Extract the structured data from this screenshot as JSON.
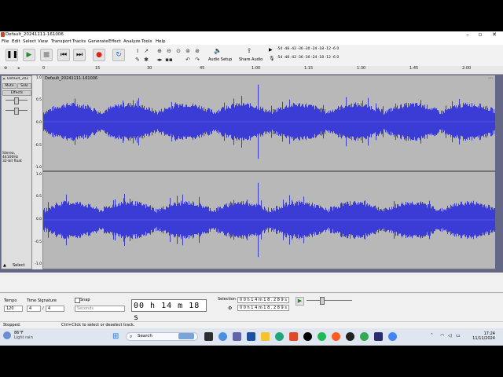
{
  "window": {
    "title": "Default_20241111-161006"
  },
  "menu": [
    "File",
    "Edit",
    "Select",
    "View",
    "Transport",
    "Tracks",
    "Generate",
    "Effect",
    "Analyze",
    "Tools",
    "Help"
  ],
  "toolbar": {
    "audio_setup": "Audio Setup",
    "share_audio": "Share Audio",
    "meter_labels": [
      "-54",
      "-48",
      "-42",
      "-36",
      "-30",
      "-24",
      "-18",
      "-12",
      "-6",
      "0"
    ]
  },
  "ruler": {
    "ticks": [
      "0",
      "15",
      "30",
      "45",
      "1:00",
      "1:15",
      "1:30",
      "1:45",
      "2:00"
    ]
  },
  "track": {
    "name": "Default_202",
    "clip_name": "Default_20241111-161006",
    "mute": "Mute",
    "solo": "Solo",
    "effects": "Effects",
    "info_line1": "Stereo, 44100Hz",
    "info_line2": "32-bit float",
    "select": "Select",
    "scale": [
      "1.0",
      "0.5",
      "0.0",
      "-0.5",
      "-1.0"
    ]
  },
  "bottom": {
    "tempo_label": "Tempo",
    "tempo_value": "120",
    "time_sig_label": "Time Signature",
    "time_sig_num": "4",
    "time_sig_den": "4",
    "snap_label": "Snap",
    "snap_unit": "Seconds",
    "time_display": "00 h 14 m 18 s",
    "selection_label": "Selection",
    "selection_start": "0 0 h 1 4 m 1 8 . 2 8 9 s",
    "selection_end": "0 0 h 1 4 m 1 8 . 2 8 9 s"
  },
  "status": {
    "left": "Stopped.",
    "hint": "Ctrl+Click to select or deselect track."
  },
  "taskbar": {
    "weather_temp": "86°F",
    "weather_desc": "Light rain",
    "search": "Search",
    "time": "17:24",
    "date": "11/11/2024"
  },
  "colors": {
    "waveform": "#3b3bd6",
    "track_bg": "#b8b8b8",
    "panel_bg": "#646685"
  }
}
